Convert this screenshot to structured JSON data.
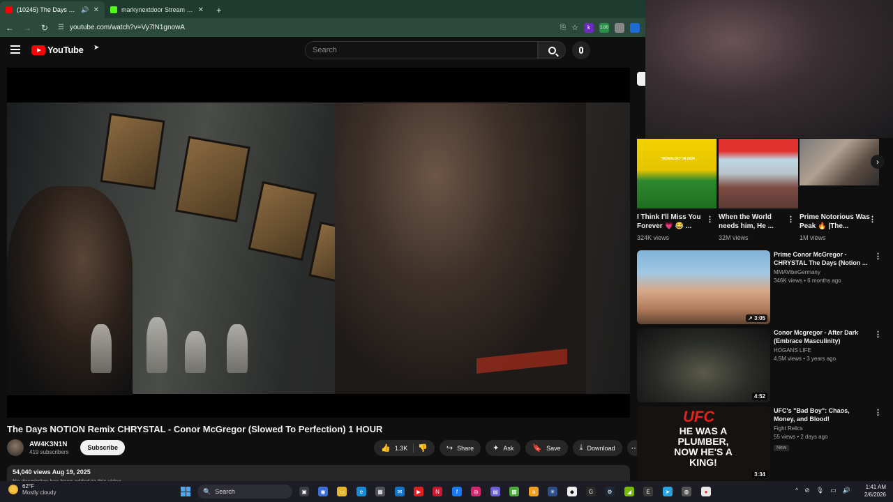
{
  "browser": {
    "tabs": [
      {
        "title": "(10245) The Days NOTION R",
        "active": true,
        "favicon_color": "#ff0000"
      },
      {
        "title": "markynextdoor Stream - Watch",
        "active": false,
        "favicon_color": "#53fc18"
      }
    ],
    "new_tab": "+",
    "url": "youtube.com/watch?v=Vy7lN1gnowA",
    "extensions": [
      {
        "label": "k",
        "color": "#6b2bbf"
      },
      {
        "label": "1.00",
        "color": "#2a8f4a"
      },
      {
        "label": "",
        "color": "#888888"
      },
      {
        "label": "",
        "color": "#1e6bd6"
      }
    ]
  },
  "youtube": {
    "logo_text": "YouTube",
    "search_placeholder": "Search",
    "video": {
      "title": "The Days NOTION Remix CHRYSTAL - Conor McGregor (Slowed To Perfection) 1 HOUR",
      "channel": "AW4K3N1N",
      "subscribers": "419 subscribers",
      "subscribe_label": "Subscribe",
      "likes": "1.3K",
      "share_label": "Share",
      "ask_label": "Ask",
      "save_label": "Save",
      "download_label": "Download",
      "views_date": "54,040 views  Aug 19, 2025",
      "description": "No description has been added to this video."
    },
    "shorts": [
      {
        "title": "I Think I'll Miss You Forever 💗 😂 ...",
        "views": "324K views",
        "thumb_caption": "\"RONALDO\" IN 2024"
      },
      {
        "title": "When the World needs him, He ...",
        "views": "32M views"
      },
      {
        "title": "Prime Notorious Was Peak 🔥 |The...",
        "views": "1M views"
      }
    ],
    "recommendations": [
      {
        "title": "Prime Conor McGregor - CHRYSTAL The Days (Notion ...",
        "channel": "MMAVibeGermany",
        "meta": "346K views • 6 months ago",
        "duration": "3:05"
      },
      {
        "title": "Conor Mcgregor - After Dark (Embrace Masculinity)",
        "channel": "HOGANS LIFE",
        "meta": "4.5M views • 3 years ago",
        "duration": "4:52"
      },
      {
        "title": "UFC's \"Bad Boy\": Chaos, Money, and Blood!",
        "channel": "Fight Relics",
        "meta": "55 views • 2 days ago",
        "badge": "New",
        "duration": "3:34",
        "thumb_text": "HE WAS A PLUMBER, NOW HE'S A KING!",
        "thumb_logo": "UFC"
      }
    ]
  },
  "taskbar": {
    "temperature": "62°F",
    "weather": "Mostly cloudy",
    "search_label": "Search",
    "time": "1:41 AM",
    "date": "2/6/2026"
  }
}
